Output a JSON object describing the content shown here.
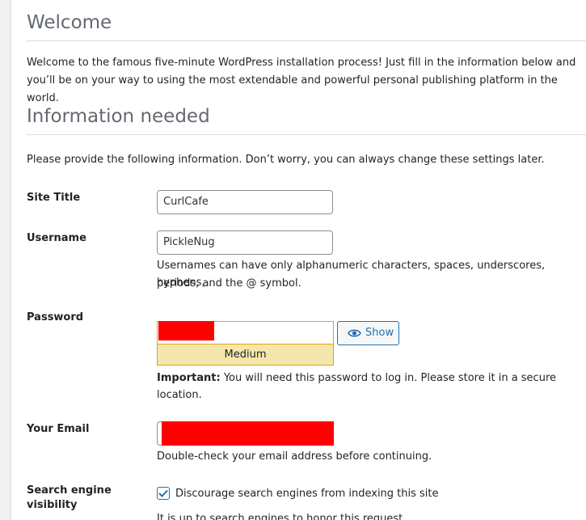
{
  "welcome": {
    "heading": "Welcome",
    "intro_line1": "Welcome to the famous five-minute WordPress installation process! Just fill in the information below and",
    "intro_line2": "you’ll be on your way to using the most extendable and powerful personal publishing platform in the world."
  },
  "info": {
    "heading": "Information needed",
    "intro": "Please provide the following information. Don’t worry, you can always change these settings later."
  },
  "form": {
    "site_title": {
      "label": "Site Title",
      "value": "CurlCafe"
    },
    "username": {
      "label": "Username",
      "value": "PickleNug",
      "hint_line1": "Usernames can have only alphanumeric characters, spaces, underscores, hyphens,",
      "hint_line2": "periods, and the @ symbol."
    },
    "password": {
      "label": "Password",
      "strength": "Medium",
      "show_label": "Show",
      "important_prefix": "Important:",
      "important_line1": " You will need this password to log in. Please store it in a secure",
      "important_line2": "location."
    },
    "email": {
      "label": "Your Email",
      "hint": "Double-check your email address before continuing."
    },
    "search_visibility": {
      "label_line1": "Search engine",
      "label_line2": "visibility",
      "checkbox_label": "Discourage search engines from indexing this site",
      "checked": true,
      "note": "It is up to search engines to honor this request."
    }
  },
  "colors": {
    "accent": "#2271b1",
    "strength_medium_bg": "#f5e6ab",
    "strength_medium_border": "#dba617",
    "redaction": "#ff0000"
  }
}
